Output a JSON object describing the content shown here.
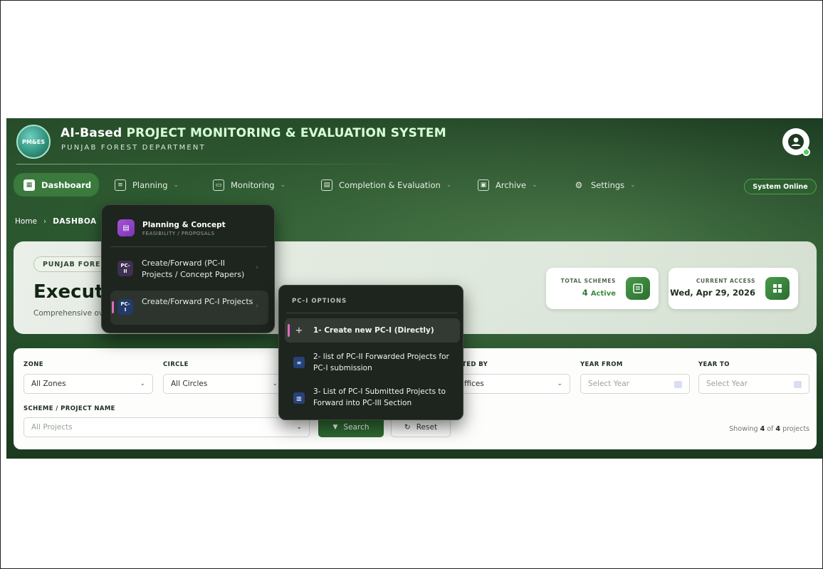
{
  "header": {
    "logo_text": "PM&ES",
    "title_prefix": "AI-Based",
    "title_main": "PROJECT MONITORING & EVALUATION SYSTEM",
    "subtitle": "PUNJAB FOREST DEPARTMENT"
  },
  "nav": {
    "items": [
      {
        "label": "Dashboard",
        "icon": "grid-icon"
      },
      {
        "label": "Planning",
        "icon": "list-icon"
      },
      {
        "label": "Monitoring",
        "icon": "monitor-icon"
      },
      {
        "label": "Completion & Evaluation",
        "icon": "chart-icon"
      },
      {
        "label": "Archive",
        "icon": "archive-icon"
      },
      {
        "label": "Settings",
        "icon": "gear-icon"
      }
    ],
    "status": "System Online"
  },
  "breadcrumb": {
    "home": "Home",
    "current": "DASHBOA"
  },
  "hero": {
    "pill": "PUNJAB FOREST",
    "title": "Executiv",
    "desc": "Comprehensive ov"
  },
  "stats": {
    "total_label": "TOTAL SCHEMES",
    "total_value": "4",
    "total_unit": "Active",
    "access_label": "CURRENT ACCESS",
    "access_value": "Wed, Apr 29, 2026"
  },
  "filters": {
    "zone_label": "ZONE",
    "zone_value": "All Zones",
    "circle_label": "CIRCLE",
    "circle_value": "All Circles",
    "submitted_label": "TED BY",
    "submitted_value": "ffices",
    "year_from_label": "YEAR FROM",
    "year_from_placeholder": "Select Year",
    "year_to_label": "YEAR TO",
    "year_to_placeholder": "Select Year",
    "scheme_label": "SCHEME / PROJECT NAME",
    "scheme_value": "All Projects",
    "search_label": "Search",
    "reset_label": "Reset",
    "showing_prefix": "Showing",
    "showing_count": "4",
    "showing_mid": "of",
    "showing_total": "4",
    "showing_suffix": "projects"
  },
  "planning_menu": {
    "head_title": "Planning & Concept",
    "head_sub": "FEASIBILITY / PROPOSALS",
    "items": [
      {
        "badge": "PC-II",
        "label": "Create/Forward (PC-II Projects / Concept Papers)"
      },
      {
        "badge": "PC-I",
        "label": "Create/Forward PC-I Projects"
      }
    ]
  },
  "pc1_menu": {
    "head": "PC-I OPTIONS",
    "items": [
      {
        "label": "1- Create new PC-I (Directly)"
      },
      {
        "label": "2- list of PC-II Forwarded Projects for PC-I submission"
      },
      {
        "label": "3- List of PC-I Submitted Projects to Forward into PC-III Section"
      }
    ]
  }
}
